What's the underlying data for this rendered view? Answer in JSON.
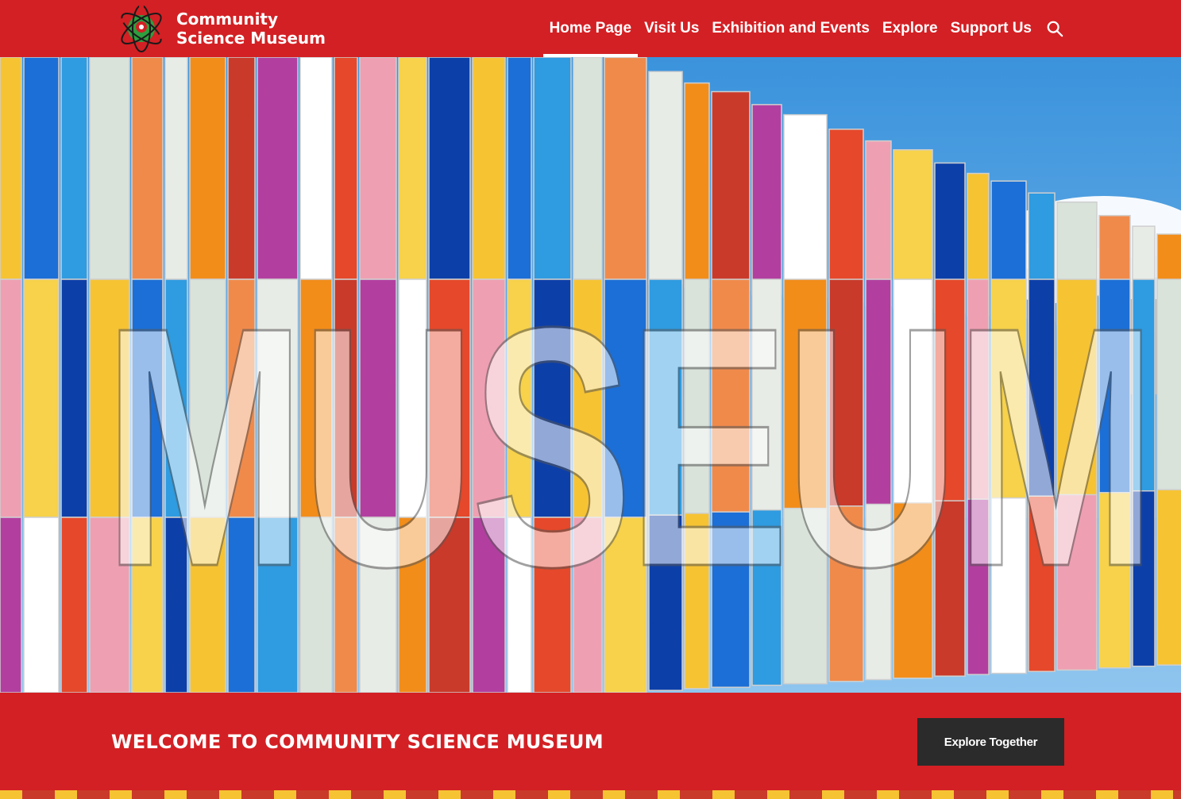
{
  "brand": {
    "name_line1": "Community",
    "name_line2": "Science Museum",
    "color": "#d32024",
    "logo_icon": "atom-globe-icon"
  },
  "nav": {
    "items": [
      {
        "label": "Home Page",
        "active": true
      },
      {
        "label": "Visit Us",
        "active": false
      },
      {
        "label": "Exhibition and Events",
        "active": false
      },
      {
        "label": "Explore",
        "active": false
      },
      {
        "label": "Support Us",
        "active": false
      }
    ],
    "search_icon": "search-icon"
  },
  "hero": {
    "image": "colorful-museum-facade-photo",
    "facade_letters": "MUSEUM"
  },
  "welcome": {
    "heading": "WELCOME TO COMMUNITY SCIENCE MUSEUM",
    "button_label": "Explore Together",
    "button_color": "#2b2b2b"
  }
}
